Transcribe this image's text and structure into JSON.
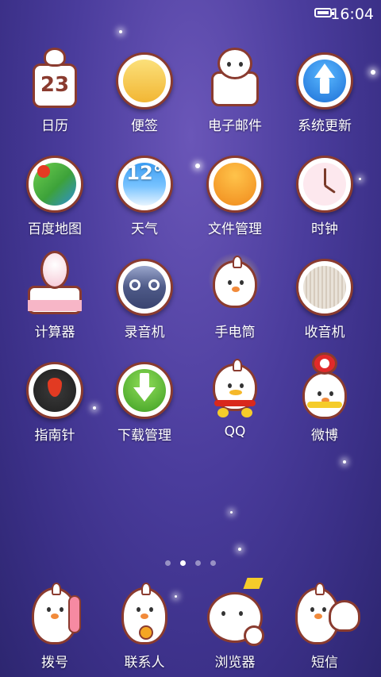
{
  "status": {
    "time": "16:04"
  },
  "apps": [
    {
      "label": "日历",
      "icon": "calendar-mascot-icon",
      "calendar_day": "23"
    },
    {
      "label": "便签",
      "icon": "notes-icon"
    },
    {
      "label": "电子邮件",
      "icon": "email-mascot-icon"
    },
    {
      "label": "系统更新",
      "icon": "system-update-icon"
    },
    {
      "label": "百度地图",
      "icon": "baidu-map-icon"
    },
    {
      "label": "天气",
      "icon": "weather-icon",
      "temperature": "12°"
    },
    {
      "label": "文件管理",
      "icon": "file-manager-icon"
    },
    {
      "label": "时钟",
      "icon": "clock-icon"
    },
    {
      "label": "计算器",
      "icon": "calculator-mascot-icon"
    },
    {
      "label": "录音机",
      "icon": "recorder-icon"
    },
    {
      "label": "手电筒",
      "icon": "flashlight-mascot-icon"
    },
    {
      "label": "收音机",
      "icon": "radio-icon"
    },
    {
      "label": "指南针",
      "icon": "compass-icon"
    },
    {
      "label": "下载管理",
      "icon": "download-manager-icon"
    },
    {
      "label": "QQ",
      "icon": "qq-mascot-icon"
    },
    {
      "label": "微博",
      "icon": "weibo-mascot-icon"
    }
  ],
  "dock": [
    {
      "label": "拨号",
      "icon": "phone-mascot-icon"
    },
    {
      "label": "联系人",
      "icon": "contacts-mascot-icon"
    },
    {
      "label": "浏览器",
      "icon": "browser-mascot-icon"
    },
    {
      "label": "短信",
      "icon": "messaging-mascot-icon"
    }
  ],
  "page_indicator": {
    "count": 4,
    "active": 2
  },
  "colors": {
    "ring": "#8a3b2f",
    "background": "#4a3c9c"
  }
}
